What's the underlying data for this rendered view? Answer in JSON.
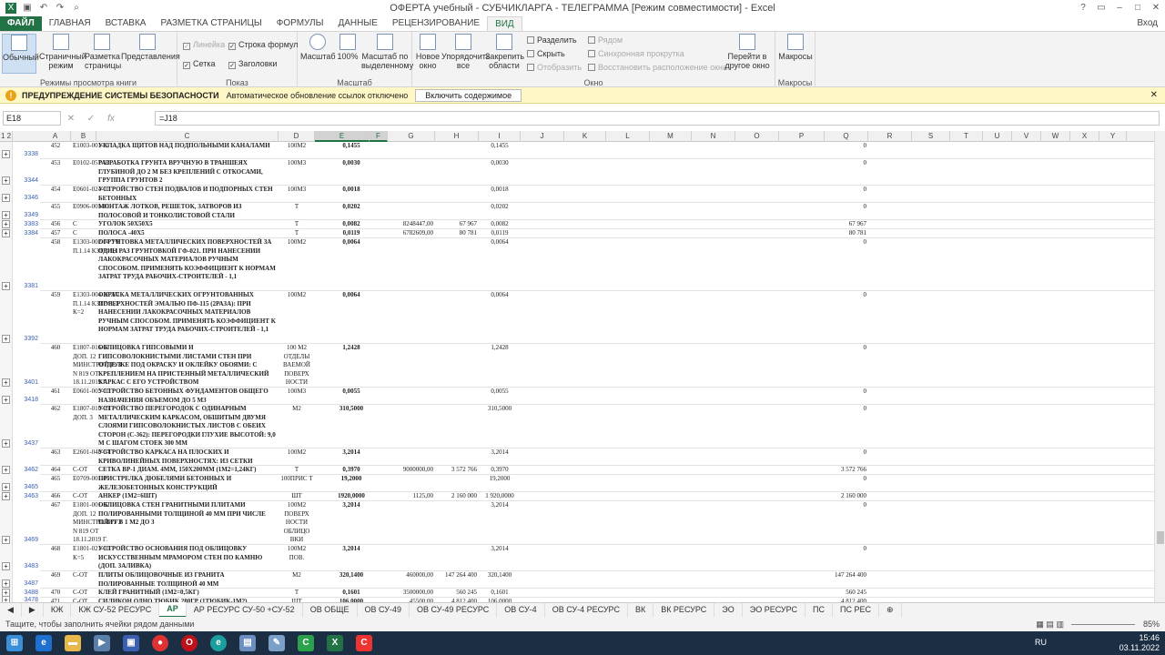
{
  "window": {
    "title": "ОФЕРТА учебный - СУБЧИКЛАРГА - ТЕЛЕГРАММА  [Режим совместимости] - Excel",
    "help": "?",
    "signin": "Вход"
  },
  "tabs": [
    "ФАЙЛ",
    "ГЛАВНАЯ",
    "ВСТАВКА",
    "РАЗМЕТКА СТРАНИЦЫ",
    "ФОРМУЛЫ",
    "ДАННЫЕ",
    "РЕЦЕНЗИРОВАНИЕ",
    "ВИД"
  ],
  "ribbon": {
    "views": {
      "normal": "Обычный",
      "pagemode": "Страничный режим",
      "pagelayout": "Разметка страницы",
      "custom": "Представления",
      "label": "Режимы просмотра книги"
    },
    "show": {
      "ruler": "Линейка",
      "formulabar": "Строка формул",
      "grid": "Сетка",
      "headings": "Заголовки",
      "label": "Показ"
    },
    "zoom": {
      "zoom": "Масштаб",
      "z100": "100%",
      "zsel": "Масштаб по выделенному",
      "label": "Масштаб"
    },
    "window": {
      "new": "Новое окно",
      "arrange": "Упорядочить все",
      "freeze": "Закрепить области",
      "split": "Разделить",
      "hide": "Скрыть",
      "unhide": "Отобразить",
      "side": "Рядом",
      "sync": "Синхронная прокрутка",
      "reset": "Восстановить расположение окна",
      "switch": "Перейти в другое окно",
      "label": "Окно"
    },
    "macros": {
      "macros": "Макросы",
      "label": "Макросы"
    }
  },
  "warning": {
    "title": "ПРЕДУПРЕЖДЕНИЕ СИСТЕМЫ БЕЗОПАСНОСТИ",
    "text": "Автоматическое обновление ссылок отключено",
    "button": "Включить содержимое"
  },
  "formula": {
    "namebox": "E18",
    "content": "=J18"
  },
  "columns": [
    "A",
    "B",
    "C",
    "D",
    "E",
    "F",
    "G",
    "H",
    "I",
    "J",
    "K",
    "L",
    "M",
    "N",
    "O",
    "P",
    "Q",
    "R",
    "S",
    "T",
    "U",
    "V",
    "W",
    "X",
    "Y"
  ],
  "rows": [
    {
      "n": "3338",
      "a": "452",
      "b": "Е1003-001-01",
      "c": "УКЛАДКА ЩИТОВ НАД ПОДПОЛЬНЫМИ КАНАЛАМИ",
      "d": "100М2",
      "e": "0,1455",
      "g": "",
      "h": "",
      "i": "0,1455",
      "q": "0"
    },
    {
      "n": "3344",
      "a": "453",
      "b": "Е0102-057-02",
      "c": "РАЗРАБОТКА ГРУНТА ВРУЧНУЮ В ТРАНШЕЯХ ГЛУБИНОЙ ДО 2 М БЕЗ КРЕПЛЕНИЙ С ОТКОСАМИ, ГРУППА ГРУНТОВ 2",
      "d": "100М3",
      "e": "0,0030",
      "g": "",
      "h": "",
      "i": "0,0030",
      "q": "0"
    },
    {
      "n": "3346",
      "a": "454",
      "b": "Е0601-024-01",
      "c": "УСТРОЙСТВО СТЕН ПОДВАЛОВ И ПОДПОРНЫХ СТЕН БЕТОННЫХ",
      "d": "100М3",
      "e": "0,0018",
      "g": "",
      "h": "",
      "i": "0,0018",
      "q": "0"
    },
    {
      "n": "3349",
      "a": "455",
      "b": "Е0906-001-01",
      "c": "МОНТАЖ ЛОТКОВ, РЕШЕТОК, ЗАТВОРОВ ИЗ ПОЛОСОВОЙ И ТОНКОЛИСТОВОЙ СТАЛИ",
      "d": "Т",
      "e": "0,0202",
      "g": "",
      "h": "",
      "i": "0,0202",
      "q": "0"
    },
    {
      "n": "3383",
      "a": "456",
      "b": "С",
      "c": "УГОЛОК 50Х50Х5",
      "d": "Т",
      "e": "0,0082",
      "g": "8248447,00",
      "h": "67 967",
      "i": "0,0082",
      "q": "67 967"
    },
    {
      "n": "3384",
      "a": "457",
      "b": "С",
      "c": "ПОЛОСА -40Х5",
      "d": "Т",
      "e": "0,0119",
      "g": "6782609,00",
      "h": "80 781",
      "i": "0,0119",
      "q": "80 781"
    },
    {
      "n": "3381",
      "a": "458",
      "b": "Е1303-002-04 ТЧ П.1.14 КЗТР=1,1",
      "c": "ОГРУНТОВКА МЕТАЛЛИЧЕСКИХ ПОВЕРХНОСТЕЙ ЗА ОДИН РАЗ ГРУНТОВКОЙ ГФ-021. ПРИ НАНЕСЕНИИ ЛАКОКРАСОЧНЫХ МАТЕРИАЛОВ РУЧНЫМ СПОСОБОМ. ПРИМЕНЯТЬ КОЭФФИЦИЕНТ К НОРМАМ ЗАТРАТ ТРУДА РАБОЧИХ-СТРОИТЕЛЕЙ - 1,1",
      "d": "100М2",
      "e": "0,0064",
      "g": "",
      "h": "",
      "i": "0,0064",
      "q": "0"
    },
    {
      "n": "3392",
      "a": "459",
      "b": "Е1303-004-26 ТЧ П.1.14 КЗТР=1,1 К=2",
      "c": "ОКРАСКА МЕТАЛЛИЧЕСКИХ ОГРУНТОВАННЫХ ПОВЕРХНОСТЕЙ ЭМАЛЬЮ ПФ-115 (2РАЗА): ПРИ НАНЕСЕНИИ ЛАКОКРАСОЧНЫХ МАТЕРИАЛОВ РУЧНЫМ СПОСОБОМ. ПРИМЕНЯТЬ КОЭФФИЦИЕНТ К НОРМАМ ЗАТРАТ ТРУДА РАБОЧИХ-СТРОИТЕЛЕЙ - 1,1",
      "d": "100М2",
      "e": "0,0064",
      "g": "",
      "h": "",
      "i": "0,0064",
      "q": "0"
    },
    {
      "n": "3401",
      "a": "460",
      "b": "Е1807-016-01 ДОП. 12 МИНСТРОЙ РУЗ N 819 ОТ 18.11.2019 Г.",
      "c": "ОБЛИЦОВКА ГИПСОВЫМИ И ГИПСОВОЛОКНИСТЫМИ ЛИСТАМИ СТЕН ПРИ ОТДЕЛКЕ ПОД ОКРАСКУ И ОКЛЕЙКУ ОБОЯМИ: С КРЕПЛЕНИЕМ НА ПРИСТЕННЫЙ МЕТАЛЛИЧЕСКИЙ КАРКАС С ЕГО УСТРОЙСТВОМ",
      "d": "100 М2 ОТДЕЛЫ ВАЕМОЙ ПОВЕРХ НОСТИ",
      "e": "1,2428",
      "g": "",
      "h": "",
      "i": "1,2428",
      "q": "0"
    },
    {
      "n": "3418",
      "a": "461",
      "b": "Е0601-005-01",
      "c": "УСТРОЙСТВО БЕТОННЫХ ФУНДАМЕНТОВ ОБЩЕГО НАЗНАЧЕНИЯ ОБЪЕМОМ ДО 5 М3",
      "d": "100М3",
      "e": "0,0055",
      "g": "",
      "h": "",
      "i": "0,0055",
      "q": "0"
    },
    {
      "n": "3437",
      "a": "462",
      "b": "Е1807-010-09 ДОП. 3",
      "c": "УСТРОЙСТВО ПЕРЕГОРОДОК С ОДИНАРНЫМ МЕТАЛЛИЧЕСКИМ КАРКАСОМ, ОБШИТЫМ ДВУМЯ СЛОЯМИ ГИПСОВОЛОКНИСТЫХ ЛИСТОВ С ОБЕИХ СТОРОН (С-362): ПЕРЕГОРОДКИ ГЛУХИЕ ВЫСОТОЙ: 9,0 М С ШАГОМ СТОЕК 300 ММ",
      "d": "М2",
      "e": "310,5000",
      "g": "",
      "h": "",
      "i": "310,5000",
      "q": "0"
    },
    {
      "n": "",
      "a": "463",
      "b": "Е2601-048-04",
      "c": "УСТРОЙСТВО КАРКАСА НА ПЛОСКИХ И КРИВОЛИНЕЙНЫХ ПОВЕРХНОСТЯХ: ИЗ СЕТКИ",
      "d": "100М2",
      "e": "3,2014",
      "g": "",
      "h": "",
      "i": "3,2014",
      "q": "0"
    },
    {
      "n": "3462",
      "a": "464",
      "b": "С-ОТ",
      "c": "СЕТКА ВР-1 ДИАМ. 4ММ, 150Х200ММ (1М2=1,24КГ)",
      "d": "Т",
      "e": "0,3970",
      "g": "9000000,00",
      "h": "3 572 766",
      "i": "0,3970",
      "q": "3 572 766"
    },
    {
      "n": "3465",
      "a": "465",
      "b": "Е0709-001-01",
      "c": "ПРИСТРЕЛКА ДЮБЕЛЯМИ БЕТОННЫХ И ЖЕЛЕЗОБЕТОННЫХ КОНСТРУКЦИЙ",
      "d": "100ПРИС Т",
      "e": "19,2000",
      "g": "",
      "h": "",
      "i": "19,2000",
      "q": "0"
    },
    {
      "n": "3463",
      "a": "466",
      "b": "С-ОТ",
      "c": "АНКЕР (1М2=6ШТ)",
      "d": "ШТ",
      "e": "1920,0000",
      "g": "1125,00",
      "h": "2 160 000",
      "i": "1 920,0000",
      "q": "2 160 000"
    },
    {
      "n": "3469",
      "a": "467",
      "b": "Е1801-001-02 ДОП. 12 МИНСТРОЙ РУЗ N 819 ОТ 18.11.2019 Г.",
      "c": "ОБЛИЦОВКА СТЕН ГРАНИТНЫМИ ПЛИТАМИ ПОЛИРОВАННЫМИ ТОЛЩИНОЙ 40 ММ ПРИ ЧИСЛЕ ПЛИТ В 1 М2 ДО 3",
      "d": "100М2 ПОВЕРХ НОСТИ ОБЛИЦО ВКИ",
      "e": "3,2014",
      "g": "",
      "h": "",
      "i": "3,2014",
      "q": "0"
    },
    {
      "n": "3483",
      "a": "468",
      "b": "Е1801-021-01 К=5",
      "c": "УСТРОЙСТВО ОСНОВАНИЯ ПОД ОБЛИЦОВКУ ИСКУССТВЕННЫМ МРАМОРОМ СТЕН ПО КАМНЮ (ДОП. ЗАЛИВКА)",
      "d": "100М2 ПОВ.",
      "e": "3,2014",
      "g": "",
      "h": "",
      "i": "3,2014",
      "q": "0"
    },
    {
      "n": "3487",
      "a": "469",
      "b": "С-ОТ",
      "c": "ПЛИТЫ ОБЛИЦОВОЧНЫЕ ИЗ ГРАНИТА ПОЛИРОВАННЫЕ ТОЛЩИНОЙ 40 ММ",
      "d": "М2",
      "e": "320,1400",
      "g": "460000,00",
      "h": "147 264 400",
      "i": "320,1400",
      "q": "147 264 400"
    },
    {
      "n": "3488",
      "a": "470",
      "b": "С-ОТ",
      "c": "КЛЕЙ ГРАНИТНЫЙ (1М2=0,5КГ)",
      "d": "Т",
      "e": "0,1601",
      "g": "3500000,00",
      "h": "560 245",
      "i": "0,1601",
      "q": "560 245"
    },
    {
      "n": "3478",
      "a": "471",
      "b": "С-ОТ",
      "c": "СИЛИКОН ОДНО ТЮБИК 280ГР (1ТЮБИК-1М2)",
      "d": "ШТ",
      "e": "106,0000",
      "g": "45500,00",
      "h": "4 812 400",
      "i": "106,0000",
      "q": "4 812 400"
    }
  ],
  "sheets": [
    "КЖ",
    "КЖ СУ-52 РЕСУРС",
    "АР",
    "АР РЕСУРС СУ-50 +СУ-52",
    "ОВ ОБЩЕ",
    "ОВ СУ-49",
    "ОВ СУ-49 РЕСУРС",
    "ОВ СУ-4",
    "ОВ СУ-4 РЕСУРС",
    "ВК",
    "ВК РЕСУРС",
    "ЭО",
    "ЭО РЕСУРС",
    "ПС",
    "ПС РЕС"
  ],
  "active_sheet": "АР",
  "status": {
    "text": "Тащите, чтобы заполнить ячейки рядом данными",
    "zoom": "85%"
  },
  "taskbar": {
    "lang": "RU",
    "time": "15:46",
    "date": "03.11.2022"
  }
}
